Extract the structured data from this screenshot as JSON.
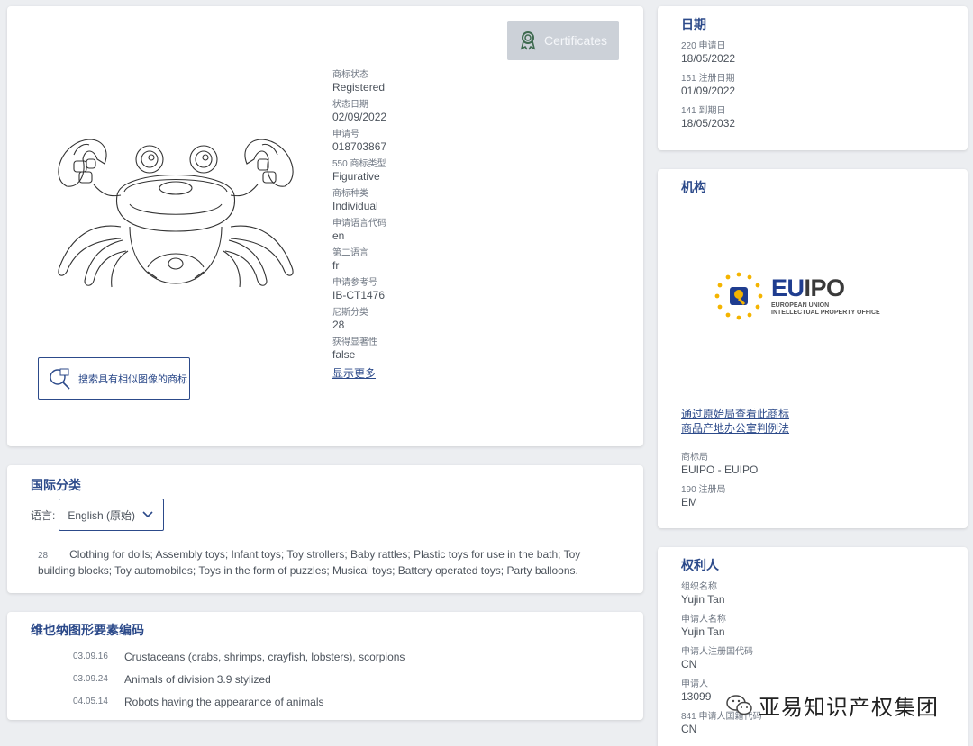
{
  "main": {
    "certificates_label": "Certificates",
    "similar_search_label": "搜索具有相似图像的商标",
    "fields": [
      {
        "label": "商标状态",
        "value": "Registered"
      },
      {
        "label": "状态日期",
        "value": "02/09/2022"
      },
      {
        "label": "申请号",
        "value": "018703867"
      },
      {
        "label": "550 商标类型",
        "value": "Figurative"
      },
      {
        "label": "商标种类",
        "value": "Individual"
      },
      {
        "label": "申请语言代码",
        "value": "en"
      },
      {
        "label": "第二语言",
        "value": "fr"
      },
      {
        "label": "申请参考号",
        "value": "IB-CT1476"
      },
      {
        "label": "尼斯分类",
        "value": "28"
      },
      {
        "label": "获得显著性",
        "value": "false"
      }
    ],
    "show_more": "显示更多"
  },
  "classification": {
    "title": "国际分类",
    "language_label": "语言:",
    "language_value": "English (原始)",
    "class_number": "28",
    "class_text": "Clothing for dolls; Assembly toys; Infant toys; Toy strollers; Baby rattles; Plastic toys for use in the bath; Toy building blocks; Toy automobiles; Toys in the form of puzzles; Musical toys; Battery operated toys; Party balloons."
  },
  "vienna": {
    "title": "维也纳图形要素编码",
    "items": [
      {
        "code": "03.09.16",
        "desc": "Crustaceans (crabs, shrimps, crayfish, lobsters), scorpions"
      },
      {
        "code": "03.09.24",
        "desc": "Animals of division 3.9 stylized"
      },
      {
        "code": "04.05.14",
        "desc": "Robots having the appearance of animals"
      }
    ]
  },
  "dates": {
    "title": "日期",
    "fields": [
      {
        "label": "220 申请日",
        "value": "18/05/2022"
      },
      {
        "label": "151 注册日期",
        "value": "01/09/2022"
      },
      {
        "label": "141 到期日",
        "value": "18/05/2032"
      }
    ]
  },
  "office": {
    "title": "机构",
    "logo_word_eu": "EU",
    "logo_word_ipo": "IPO",
    "logo_sub1": "EUROPEAN UNION",
    "logo_sub2": "INTELLECTUAL PROPERTY OFFICE",
    "link1": "通过原始局查看此商标",
    "link2": "商品产地办公室判例法",
    "fields": [
      {
        "label": "商标局",
        "value": "EUIPO - EUIPO"
      },
      {
        "label": "190 注册局",
        "value": "EM"
      }
    ]
  },
  "owner": {
    "title": "权利人",
    "fields": [
      {
        "label": "组织名称",
        "value": "Yujin Tan"
      },
      {
        "label": "申请人名称",
        "value": "Yujin Tan"
      },
      {
        "label": "申请人注册国代码",
        "value": "CN"
      },
      {
        "label": "申请人",
        "value": "13099"
      },
      {
        "label": "841 申请人国籍代码",
        "value": "CN"
      }
    ]
  },
  "watermark": "亚易知识产权集团",
  "colors": {
    "accent": "#2c4a8a",
    "background": "#eceef1",
    "euipo_blue": "#1f3d8f",
    "euipo_gold": "#f4b400"
  }
}
